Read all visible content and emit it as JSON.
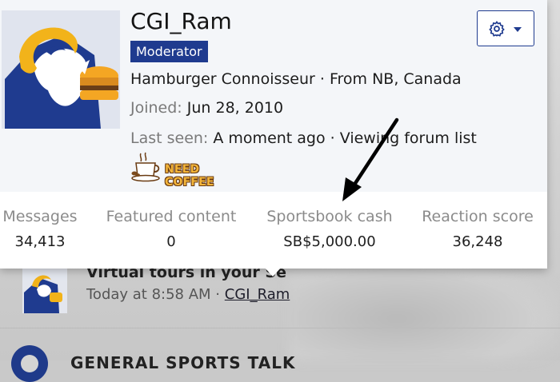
{
  "profile_popup": {
    "username": "CGI_Ram",
    "role_badge": "Moderator",
    "user_title": "Hamburger Connoisseur · From NB, Canada",
    "joined_label": "Joined:",
    "joined_value": "Jun 28, 2010",
    "last_seen_label": "Last seen:",
    "last_seen_value": "A moment ago · Viewing forum list",
    "banner_text": "NEED COFFEE",
    "settings_icon": "gear-icon",
    "settings_caret_icon": "caret-down-icon",
    "accent_color": "#1f3b8f",
    "stats": [
      {
        "label": "Messages",
        "value": "34,413"
      },
      {
        "label": "Featured content",
        "value": "0"
      },
      {
        "label": "Sportsbook cash",
        "value": "SB$5,000.00"
      },
      {
        "label": "Reaction score",
        "value": "36,248"
      }
    ]
  },
  "background": {
    "thread_title": "Virtual tours in your S",
    "thread_title_tail": "e",
    "thread_time": "Today at 8:58 AM ·",
    "thread_author": "CGI_Ram",
    "section_title": "GENERAL SPORTS TALK"
  },
  "annotation": {
    "arrow_icon": "arrow-annotation-icon"
  }
}
